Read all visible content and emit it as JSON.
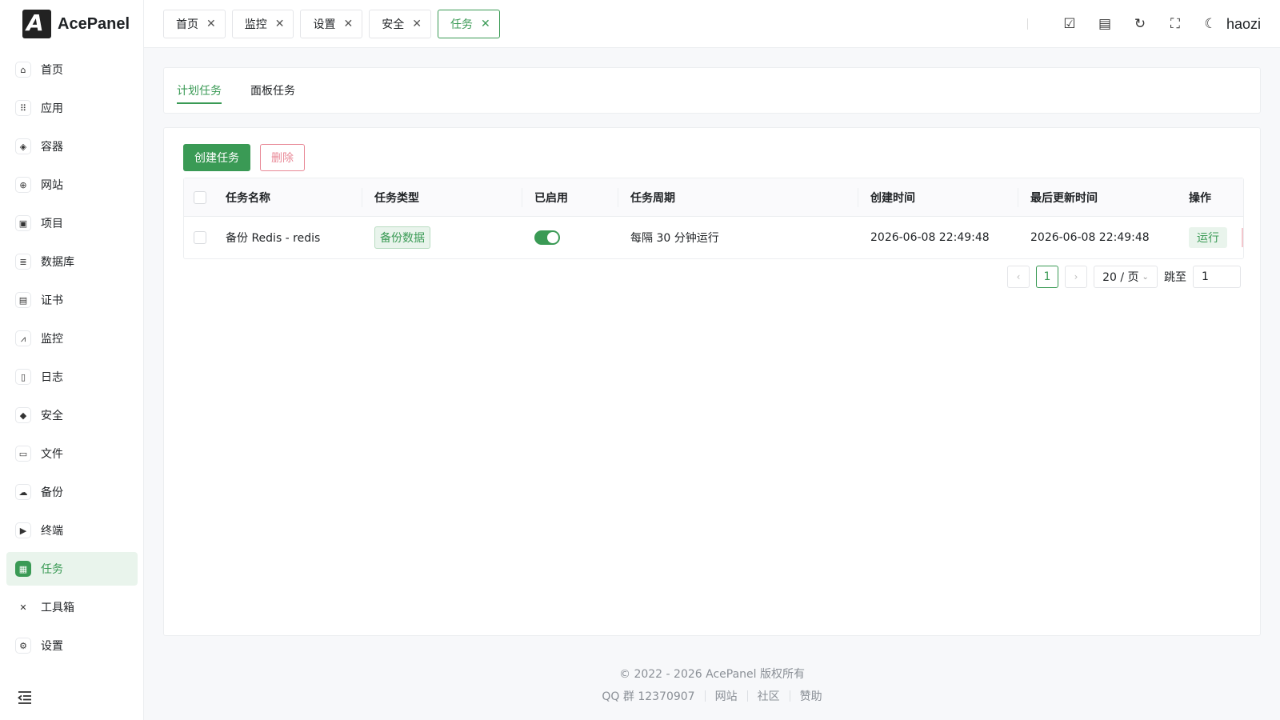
{
  "brand": {
    "name": "AcePanel",
    "mark": "A"
  },
  "colors": {
    "accent": "#3a9a55",
    "danger": "#e88896"
  },
  "sidebar": {
    "items": [
      {
        "label": "首页",
        "icon": "home-icon",
        "glyph": "⌂"
      },
      {
        "label": "应用",
        "icon": "grid-icon",
        "glyph": "⠿"
      },
      {
        "label": "容器",
        "icon": "layers-icon",
        "glyph": "◈"
      },
      {
        "label": "网站",
        "icon": "globe-icon",
        "glyph": "⊕"
      },
      {
        "label": "项目",
        "icon": "folder-stack-icon",
        "glyph": "▣"
      },
      {
        "label": "数据库",
        "icon": "database-icon",
        "glyph": "≣"
      },
      {
        "label": "证书",
        "icon": "certificate-icon",
        "glyph": "▤"
      },
      {
        "label": "监控",
        "icon": "chart-line-icon",
        "glyph": "⩘"
      },
      {
        "label": "日志",
        "icon": "document-icon",
        "glyph": "▯"
      },
      {
        "label": "安全",
        "icon": "shield-icon",
        "glyph": "◆"
      },
      {
        "label": "文件",
        "icon": "folder-open-icon",
        "glyph": "▭"
      },
      {
        "label": "备份",
        "icon": "cloud-upload-icon",
        "glyph": "☁"
      },
      {
        "label": "终端",
        "icon": "terminal-icon",
        "glyph": "▶"
      },
      {
        "label": "任务",
        "icon": "task-list-icon",
        "glyph": "▦"
      },
      {
        "label": "工具箱",
        "icon": "tools-icon",
        "glyph": "✕"
      },
      {
        "label": "设置",
        "icon": "gear-icon",
        "glyph": "⚙"
      }
    ],
    "active": "任务",
    "collapse_icon": "menu-collapse-icon"
  },
  "header": {
    "tabs": [
      {
        "label": "首页"
      },
      {
        "label": "监控"
      },
      {
        "label": "设置"
      },
      {
        "label": "安全"
      },
      {
        "label": "任务"
      }
    ],
    "active_tab": "任务",
    "close_glyph": "✕",
    "icons": [
      {
        "name": "checkbox-task-icon",
        "glyph": "☑"
      },
      {
        "name": "document-icon",
        "glyph": "▤"
      },
      {
        "name": "refresh-icon",
        "glyph": "↻"
      },
      {
        "name": "fullscreen-icon",
        "glyph": "⛶"
      },
      {
        "name": "moon-icon",
        "glyph": "☾"
      }
    ],
    "user": "haozi"
  },
  "subtabs": {
    "items": [
      "计划任务",
      "面板任务"
    ],
    "active": "计划任务"
  },
  "toolbar": {
    "create_label": "创建任务",
    "delete_label": "删除"
  },
  "table": {
    "columns": [
      "任务名称",
      "任务类型",
      "已启用",
      "任务周期",
      "创建时间",
      "最后更新时间",
      "操作"
    ],
    "rows": [
      {
        "name": "备份 Redis - redis",
        "type": "备份数据",
        "enabled": true,
        "cycle": "每隔 30 分钟运行",
        "created": "2026-06-08 22:49:48",
        "updated": "2026-06-08 22:49:48",
        "action": "运行"
      }
    ]
  },
  "pagination": {
    "prev_glyph": "‹",
    "next_glyph": "›",
    "current_page": "1",
    "page_size": "20 / 页",
    "jump_label": "跳至",
    "jump_value": "1"
  },
  "footer": {
    "copyright": "© 2022 - 2026 AcePanel 版权所有",
    "links": [
      "QQ 群 12370907",
      "网站",
      "社区",
      "赞助"
    ]
  }
}
